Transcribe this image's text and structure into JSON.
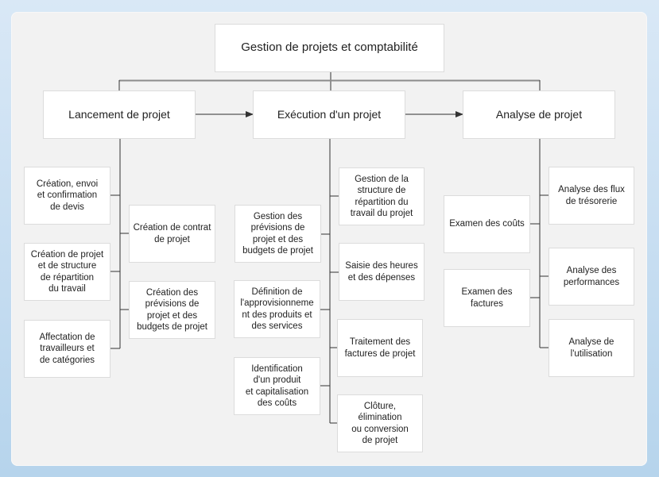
{
  "diagram": {
    "root": {
      "label": "Gestion de projets et comptabilité"
    },
    "phases": [
      {
        "label": "Lancement de projet"
      },
      {
        "label": "Exécution d'un projet"
      },
      {
        "label": "Analyse de projet"
      }
    ],
    "launch_items": [
      {
        "label": "Création, envoi\net confirmation\nde devis"
      },
      {
        "label": "Création de contrat\nde projet"
      },
      {
        "label": "Création de projet\net de structure\nde répartition\ndu travail"
      },
      {
        "label": "Création des\nprévisions de\nprojet et des\nbudgets de projet"
      },
      {
        "label": "Affectation de\ntravailleurs et\nde catégories"
      }
    ],
    "execution_items": [
      {
        "label": "Gestion de la\nstructure de\nrépartition du\ntravail du projet"
      },
      {
        "label": "Gestion des\nprévisions de\nprojet et des\nbudgets de projet"
      },
      {
        "label": "Saisie des heures\net des dépenses"
      },
      {
        "label": "Définition de\nl'approvisionneme\nnt des produits et\ndes services"
      },
      {
        "label": "Traitement des\nfactures de projet"
      },
      {
        "label": "Identification\nd'un produit\net capitalisation\ndes coûts"
      },
      {
        "label": "Clôture,\nélimination\nou conversion\nde projet"
      }
    ],
    "analysis_items": [
      {
        "label": "Analyse des flux\nde trésorerie"
      },
      {
        "label": "Examen des coûts"
      },
      {
        "label": "Analyse des\nperformances"
      },
      {
        "label": "Examen des\nfactures"
      },
      {
        "label": "Analyse de\nl'utilisation"
      }
    ],
    "colors": {
      "background": "#c6ddf1",
      "panel": "#f2f2f2",
      "box": "#ffffff",
      "connector": "#333333",
      "top_bus": "#8c8c8c"
    }
  }
}
